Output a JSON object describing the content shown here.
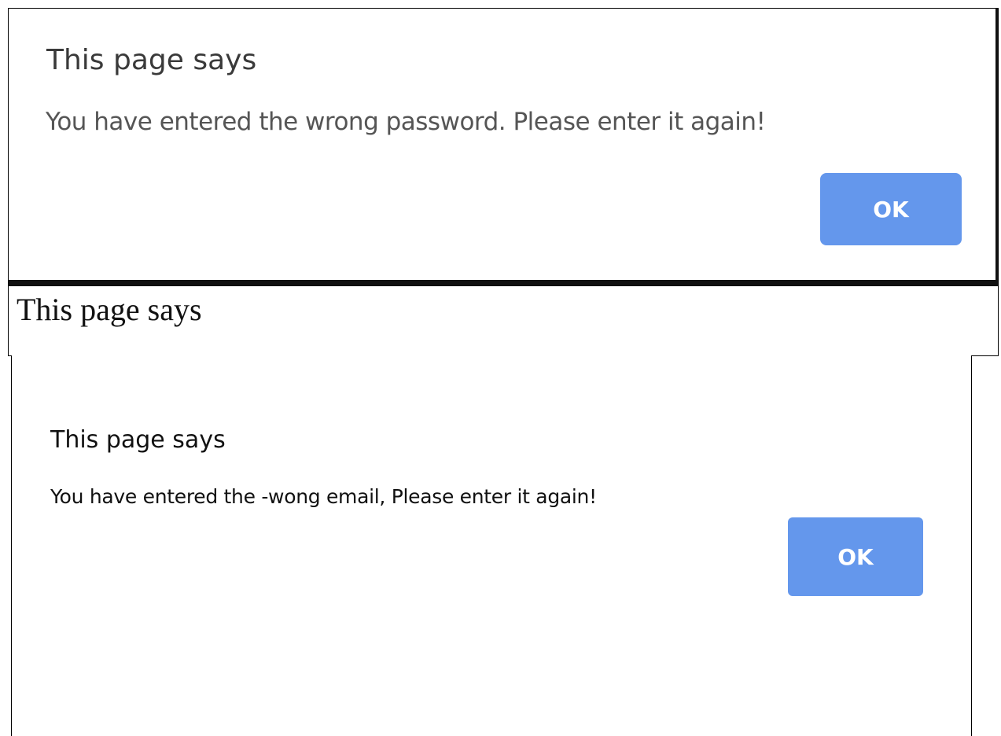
{
  "dialog_password": {
    "title": "This page says",
    "message": "You have entered the wrong password. Please enter it again!",
    "ok_label": "OK"
  },
  "caption": {
    "text": "This page says"
  },
  "dialog_email": {
    "title": "This page says",
    "message": "You have entered the -wong email, Please enter it again!",
    "ok_label": "OK"
  },
  "colors": {
    "button_blue": "#6497ec",
    "button_text": "#ffffff",
    "message_gray": "#555555",
    "border_black": "#111111"
  }
}
